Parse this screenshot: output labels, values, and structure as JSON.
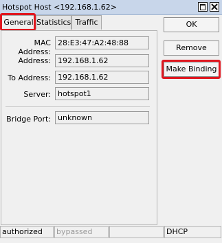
{
  "window": {
    "title": "Hotspot Host <192.168.1.62>"
  },
  "tabs": [
    {
      "label": "General"
    },
    {
      "label": "Statistics"
    },
    {
      "label": "Traffic"
    }
  ],
  "form": {
    "mac_label": "MAC Address:",
    "mac_value": "28:E3:47:A2:48:88",
    "address_label": "Address:",
    "address_value": "192.168.1.62",
    "to_address_label": "To Address:",
    "to_address_value": "192.168.1.62",
    "server_label": "Server:",
    "server_value": "hotspot1",
    "bridge_port_label": "Bridge Port:",
    "bridge_port_value": "unknown"
  },
  "buttons": {
    "ok": "OK",
    "remove": "Remove",
    "make_binding": "Make Binding"
  },
  "status": {
    "authorized": "authorized",
    "bypassed": "bypassed",
    "empty": "",
    "dhcp": "DHCP"
  },
  "colors": {
    "highlight": "#e0171f",
    "titlebar": "#c8d6ea"
  }
}
